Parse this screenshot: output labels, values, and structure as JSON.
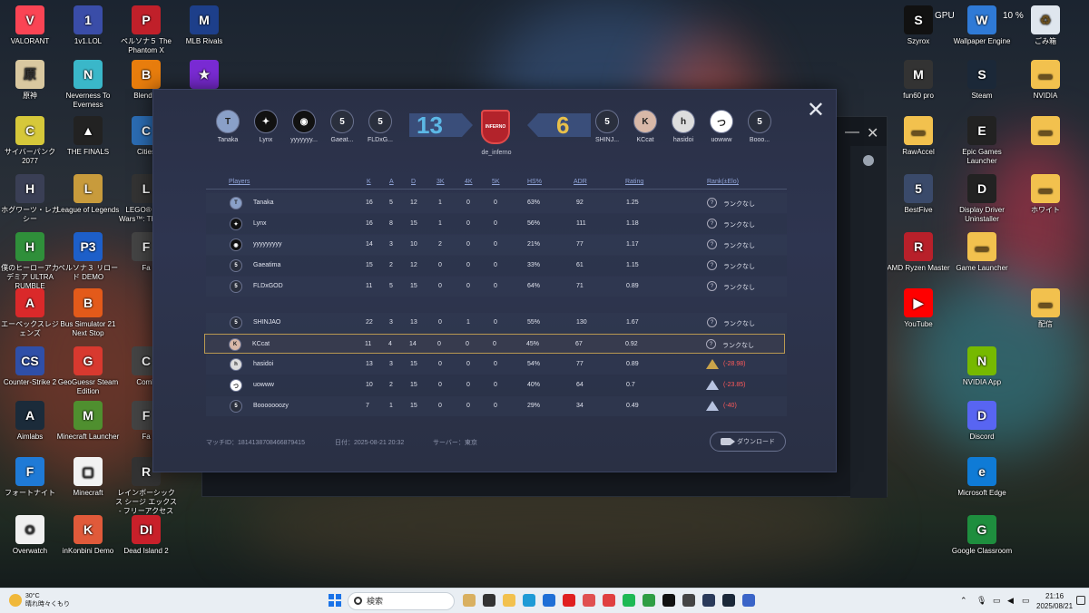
{
  "desktop": {
    "left_icons": [
      {
        "label": "VALORANT",
        "color": "#fa4454",
        "glyph": "V"
      },
      {
        "label": "1v1.LOL",
        "color": "#3a4da8",
        "glyph": "1"
      },
      {
        "label": "ペルソナ５ The Phantom X",
        "color": "#c0202a",
        "glyph": "P"
      },
      {
        "label": "MLB Rivals",
        "color": "#1d3f8a",
        "glyph": "M"
      },
      {
        "label": "原神",
        "color": "#d9c8a0",
        "glyph": "原"
      },
      {
        "label": "Neverness To Everness",
        "color": "#3ab7c9",
        "glyph": "N"
      },
      {
        "label": "Blender",
        "color": "#e87d0d",
        "glyph": "B"
      },
      {
        "label": "",
        "color": "#7a2bd4",
        "glyph": "★"
      },
      {
        "label": "サイバーパンク2077",
        "color": "#d6c83a",
        "glyph": "C"
      },
      {
        "label": "THE FINALS",
        "color": "#222",
        "glyph": "▲"
      },
      {
        "label": "Cities",
        "color": "#2b6cb3",
        "glyph": "C"
      },
      {
        "label": "ホグワーツ・レガシー",
        "color": "#3a3f55",
        "glyph": "H"
      },
      {
        "label": "League of Legends",
        "color": "#c89b3c",
        "glyph": "L"
      },
      {
        "label": "LEGO® Star Wars™: The Sky",
        "color": "#333",
        "glyph": "L"
      },
      {
        "label": "僕のヒーローアカデミア ULTRA RUMBLE",
        "color": "#2f8f3a",
        "glyph": "H"
      },
      {
        "label": "ペルソナ３ リロード DEMO",
        "color": "#1d5fc9",
        "glyph": "P3"
      },
      {
        "label": "Fa",
        "color": "#444",
        "glyph": "F"
      },
      {
        "label": "エーペックスレジェンズ",
        "color": "#da292a",
        "glyph": "A"
      },
      {
        "label": "Bus Simulator 21 Next Stop",
        "color": "#e35a1a",
        "glyph": "B"
      },
      {
        "label": "Counter-Strike 2",
        "color": "#2f4fa8",
        "glyph": "CS"
      },
      {
        "label": "GeoGuessr Steam Edition",
        "color": "#d8392f",
        "glyph": "G"
      },
      {
        "label": "Comb",
        "color": "#444",
        "glyph": "C"
      },
      {
        "label": "Aimlabs",
        "color": "#1b2b3a",
        "glyph": "A"
      },
      {
        "label": "Minecraft Launcher",
        "color": "#4f8f2f",
        "glyph": "M"
      },
      {
        "label": "Fa",
        "color": "#444",
        "glyph": "F"
      },
      {
        "label": "フォートナイト",
        "color": "#1f7ad6",
        "glyph": "F"
      },
      {
        "label": "Minecraft",
        "color": "#f2f2f2",
        "glyph": "▢"
      },
      {
        "label": "レインボーシックス シージ エックス - フリーアクセス",
        "color": "#333",
        "glyph": "R"
      },
      {
        "label": "Overwatch",
        "color": "#f0f0f0",
        "glyph": "O"
      },
      {
        "label": "inKonbini Demo",
        "color": "#e05a3a",
        "glyph": "K"
      },
      {
        "label": "Dead Island 2",
        "color": "#c8202a",
        "glyph": "DI"
      }
    ],
    "right_icons": [
      {
        "label": "Szyrox",
        "color": "#111",
        "glyph": "S"
      },
      {
        "label": "Wallpaper Engine",
        "color": "#2f7ad6",
        "glyph": "W"
      },
      {
        "label": "ごみ箱",
        "color": "#dfe6ee",
        "glyph": "♻"
      },
      {
        "label": "fun60 pro",
        "color": "#333",
        "glyph": "M"
      },
      {
        "label": "Steam",
        "color": "#1b2838",
        "glyph": "S"
      },
      {
        "label": "NVIDIA",
        "color": "#f2c14e",
        "glyph": "▬"
      },
      {
        "label": "RawAccel",
        "color": "#f2c14e",
        "glyph": "▬"
      },
      {
        "label": "Epic Games Launcher",
        "color": "#222",
        "glyph": "E"
      },
      {
        "label": "",
        "color": "#f2c14e",
        "glyph": "▬"
      },
      {
        "label": "BestFive",
        "color": "#3a4a6a",
        "glyph": "5"
      },
      {
        "label": "Display Driver Uninstaller",
        "color": "#222",
        "glyph": "D"
      },
      {
        "label": "ホワイト",
        "color": "#f2c14e",
        "glyph": "▬"
      },
      {
        "label": "AMD Ryzen Master",
        "color": "#b8202a",
        "glyph": "R"
      },
      {
        "label": "Game Launcher",
        "color": "#f2c14e",
        "glyph": "▬"
      },
      {
        "label": "YouTube",
        "color": "#ff0000",
        "glyph": "▶"
      },
      {
        "label": "配信",
        "color": "#f2c14e",
        "glyph": "▬"
      },
      {
        "label": "NVIDIA App",
        "color": "#76b900",
        "glyph": "N"
      },
      {
        "label": "Discord",
        "color": "#5865f2",
        "glyph": "D"
      },
      {
        "label": "Microsoft Edge",
        "color": "#0f7bd6",
        "glyph": "e"
      },
      {
        "label": "Google Classroom",
        "color": "#1e8e3e",
        "glyph": "G"
      }
    ],
    "tr_gpu": "GPU",
    "tr_percent": "10 %"
  },
  "match": {
    "team_a": [
      {
        "name": "Tanaka",
        "color": "#8aa0c8",
        "glyph": "T"
      },
      {
        "name": "Lynx",
        "color": "#111",
        "glyph": "✦"
      },
      {
        "name": "yyyyyyy...",
        "color": "#111",
        "glyph": "◉"
      },
      {
        "name": "Gaeat...",
        "color": "#2a2f3d",
        "glyph": "5"
      },
      {
        "name": "FLDxG...",
        "color": "#2a2f3d",
        "glyph": "5"
      }
    ],
    "team_b": [
      {
        "name": "SHINJ...",
        "color": "#2a2f3d",
        "glyph": "5"
      },
      {
        "name": "KCcat",
        "color": "#d8b8a8",
        "glyph": "K"
      },
      {
        "name": "hasidoi",
        "color": "#ddd",
        "glyph": "h"
      },
      {
        "name": "uowww",
        "color": "#fff",
        "glyph": "つ"
      },
      {
        "name": "Booo...",
        "color": "#2a2f3d",
        "glyph": "5"
      }
    ],
    "score_a": "13",
    "score_b": "6",
    "score_a_color": "#5cb8e6",
    "score_b_color": "#e8c04a",
    "map_badge": "INFERNO",
    "map_name": "de_inferno",
    "headers": {
      "players": "Players",
      "k": "K",
      "a": "A",
      "d": "D",
      "k3": "3K",
      "k4": "4K",
      "k5": "5K",
      "hs": "HS%",
      "adr": "ADR",
      "rating": "Rating",
      "rank": "Rank(±Elo)"
    },
    "rows_a": [
      {
        "name": "Tanaka",
        "k": "16",
        "a": "5",
        "d": "12",
        "k3": "1",
        "k4": "0",
        "k5": "0",
        "hs": "63%",
        "adr": "92",
        "rating": "1.25",
        "rank": "ランクなし",
        "av": "#8aa0c8",
        "glyph": "T"
      },
      {
        "name": "Lynx",
        "k": "16",
        "a": "8",
        "d": "15",
        "k3": "1",
        "k4": "0",
        "k5": "0",
        "hs": "56%",
        "adr": "111",
        "rating": "1.18",
        "rank": "ランクなし",
        "av": "#111",
        "glyph": "✦"
      },
      {
        "name": "yyyyyyyyy",
        "k": "14",
        "a": "3",
        "d": "10",
        "k3": "2",
        "k4": "0",
        "k5": "0",
        "hs": "21%",
        "adr": "77",
        "rating": "1.17",
        "rank": "ランクなし",
        "av": "#111",
        "glyph": "◉"
      },
      {
        "name": "Gaeatima",
        "k": "15",
        "a": "2",
        "d": "12",
        "k3": "0",
        "k4": "0",
        "k5": "0",
        "hs": "33%",
        "adr": "61",
        "rating": "1.15",
        "rank": "ランクなし",
        "av": "#2a2f3d",
        "glyph": "5"
      },
      {
        "name": "FLDxGOD",
        "k": "11",
        "a": "5",
        "d": "15",
        "k3": "0",
        "k4": "0",
        "k5": "0",
        "hs": "64%",
        "adr": "71",
        "rating": "0.89",
        "rank": "ランクなし",
        "av": "#2a2f3d",
        "glyph": "5"
      }
    ],
    "rows_b": [
      {
        "name": "SHINJAO",
        "k": "22",
        "a": "3",
        "d": "13",
        "k3": "0",
        "k4": "1",
        "k5": "0",
        "hs": "55%",
        "adr": "130",
        "rating": "1.67",
        "rank": "ランクなし",
        "rank_type": "none",
        "av": "#2a2f3d",
        "glyph": "5"
      },
      {
        "name": "KCcat",
        "k": "11",
        "a": "4",
        "d": "14",
        "k3": "0",
        "k4": "0",
        "k5": "0",
        "hs": "45%",
        "adr": "67",
        "rating": "0.92",
        "rank": "ランクなし",
        "rank_type": "none",
        "av": "#d8b8a8",
        "glyph": "K"
      },
      {
        "name": "hasidoi",
        "k": "13",
        "a": "3",
        "d": "15",
        "k3": "0",
        "k4": "0",
        "k5": "0",
        "hs": "54%",
        "adr": "77",
        "rating": "0.89",
        "rank": "(-28.98)",
        "rank_type": "gold",
        "av": "#ddd",
        "glyph": "h"
      },
      {
        "name": "uowww",
        "k": "10",
        "a": "2",
        "d": "15",
        "k3": "0",
        "k4": "0",
        "k5": "0",
        "hs": "40%",
        "adr": "64",
        "rating": "0.7",
        "rank": "(-23.85)",
        "rank_type": "blue",
        "av": "#fff",
        "glyph": "つ"
      },
      {
        "name": "Booooooozy",
        "k": "7",
        "a": "1",
        "d": "15",
        "k3": "0",
        "k4": "0",
        "k5": "0",
        "hs": "29%",
        "adr": "34",
        "rating": "0.49",
        "rank": "(-40)",
        "rank_type": "blue",
        "av": "#2a2f3d",
        "glyph": "5"
      }
    ],
    "match_id": "マッチID：1814138708466879415",
    "date": "日付：2025-08-21 20:32",
    "server": "サーバー：東京",
    "download": "ダウンロード",
    "rank_negative_color": "#ff5a5a"
  },
  "taskbar": {
    "temp": "30°C",
    "weather": "晴れ時々くもり",
    "search": "検索",
    "time": "21:16",
    "date": "2025/08/21"
  }
}
